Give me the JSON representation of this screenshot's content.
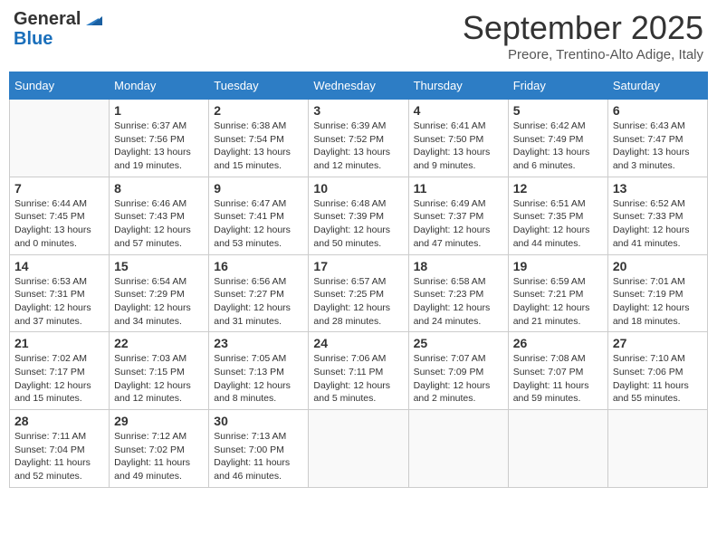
{
  "logo": {
    "general": "General",
    "blue": "Blue"
  },
  "title": "September 2025",
  "subtitle": "Preore, Trentino-Alto Adige, Italy",
  "weekdays": [
    "Sunday",
    "Monday",
    "Tuesday",
    "Wednesday",
    "Thursday",
    "Friday",
    "Saturday"
  ],
  "weeks": [
    [
      {
        "day": "",
        "info": ""
      },
      {
        "day": "1",
        "info": "Sunrise: 6:37 AM\nSunset: 7:56 PM\nDaylight: 13 hours\nand 19 minutes."
      },
      {
        "day": "2",
        "info": "Sunrise: 6:38 AM\nSunset: 7:54 PM\nDaylight: 13 hours\nand 15 minutes."
      },
      {
        "day": "3",
        "info": "Sunrise: 6:39 AM\nSunset: 7:52 PM\nDaylight: 13 hours\nand 12 minutes."
      },
      {
        "day": "4",
        "info": "Sunrise: 6:41 AM\nSunset: 7:50 PM\nDaylight: 13 hours\nand 9 minutes."
      },
      {
        "day": "5",
        "info": "Sunrise: 6:42 AM\nSunset: 7:49 PM\nDaylight: 13 hours\nand 6 minutes."
      },
      {
        "day": "6",
        "info": "Sunrise: 6:43 AM\nSunset: 7:47 PM\nDaylight: 13 hours\nand 3 minutes."
      }
    ],
    [
      {
        "day": "7",
        "info": "Sunrise: 6:44 AM\nSunset: 7:45 PM\nDaylight: 13 hours\nand 0 minutes."
      },
      {
        "day": "8",
        "info": "Sunrise: 6:46 AM\nSunset: 7:43 PM\nDaylight: 12 hours\nand 57 minutes."
      },
      {
        "day": "9",
        "info": "Sunrise: 6:47 AM\nSunset: 7:41 PM\nDaylight: 12 hours\nand 53 minutes."
      },
      {
        "day": "10",
        "info": "Sunrise: 6:48 AM\nSunset: 7:39 PM\nDaylight: 12 hours\nand 50 minutes."
      },
      {
        "day": "11",
        "info": "Sunrise: 6:49 AM\nSunset: 7:37 PM\nDaylight: 12 hours\nand 47 minutes."
      },
      {
        "day": "12",
        "info": "Sunrise: 6:51 AM\nSunset: 7:35 PM\nDaylight: 12 hours\nand 44 minutes."
      },
      {
        "day": "13",
        "info": "Sunrise: 6:52 AM\nSunset: 7:33 PM\nDaylight: 12 hours\nand 41 minutes."
      }
    ],
    [
      {
        "day": "14",
        "info": "Sunrise: 6:53 AM\nSunset: 7:31 PM\nDaylight: 12 hours\nand 37 minutes."
      },
      {
        "day": "15",
        "info": "Sunrise: 6:54 AM\nSunset: 7:29 PM\nDaylight: 12 hours\nand 34 minutes."
      },
      {
        "day": "16",
        "info": "Sunrise: 6:56 AM\nSunset: 7:27 PM\nDaylight: 12 hours\nand 31 minutes."
      },
      {
        "day": "17",
        "info": "Sunrise: 6:57 AM\nSunset: 7:25 PM\nDaylight: 12 hours\nand 28 minutes."
      },
      {
        "day": "18",
        "info": "Sunrise: 6:58 AM\nSunset: 7:23 PM\nDaylight: 12 hours\nand 24 minutes."
      },
      {
        "day": "19",
        "info": "Sunrise: 6:59 AM\nSunset: 7:21 PM\nDaylight: 12 hours\nand 21 minutes."
      },
      {
        "day": "20",
        "info": "Sunrise: 7:01 AM\nSunset: 7:19 PM\nDaylight: 12 hours\nand 18 minutes."
      }
    ],
    [
      {
        "day": "21",
        "info": "Sunrise: 7:02 AM\nSunset: 7:17 PM\nDaylight: 12 hours\nand 15 minutes."
      },
      {
        "day": "22",
        "info": "Sunrise: 7:03 AM\nSunset: 7:15 PM\nDaylight: 12 hours\nand 12 minutes."
      },
      {
        "day": "23",
        "info": "Sunrise: 7:05 AM\nSunset: 7:13 PM\nDaylight: 12 hours\nand 8 minutes."
      },
      {
        "day": "24",
        "info": "Sunrise: 7:06 AM\nSunset: 7:11 PM\nDaylight: 12 hours\nand 5 minutes."
      },
      {
        "day": "25",
        "info": "Sunrise: 7:07 AM\nSunset: 7:09 PM\nDaylight: 12 hours\nand 2 minutes."
      },
      {
        "day": "26",
        "info": "Sunrise: 7:08 AM\nSunset: 7:07 PM\nDaylight: 11 hours\nand 59 minutes."
      },
      {
        "day": "27",
        "info": "Sunrise: 7:10 AM\nSunset: 7:06 PM\nDaylight: 11 hours\nand 55 minutes."
      }
    ],
    [
      {
        "day": "28",
        "info": "Sunrise: 7:11 AM\nSunset: 7:04 PM\nDaylight: 11 hours\nand 52 minutes."
      },
      {
        "day": "29",
        "info": "Sunrise: 7:12 AM\nSunset: 7:02 PM\nDaylight: 11 hours\nand 49 minutes."
      },
      {
        "day": "30",
        "info": "Sunrise: 7:13 AM\nSunset: 7:00 PM\nDaylight: 11 hours\nand 46 minutes."
      },
      {
        "day": "",
        "info": ""
      },
      {
        "day": "",
        "info": ""
      },
      {
        "day": "",
        "info": ""
      },
      {
        "day": "",
        "info": ""
      }
    ]
  ]
}
